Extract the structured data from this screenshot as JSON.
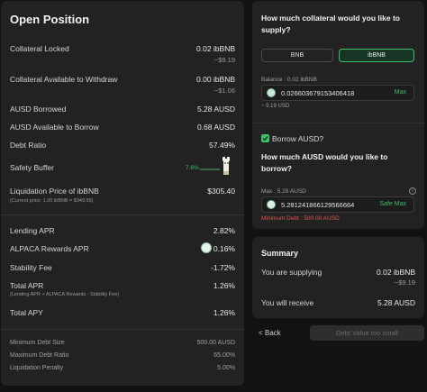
{
  "left": {
    "title": "Open Position",
    "rows": [
      {
        "label": "Collateral Locked",
        "value": "0.02 ibBNB",
        "sub": "~$9.19"
      },
      {
        "label": "Collateral Available to Withdraw",
        "value": "0.00 ibBNB",
        "sub": "~$1.06"
      },
      {
        "label": "AUSD Borrowed",
        "value": "5.28 AUSD"
      },
      {
        "label": "AUSD Available to Borrow",
        "value": "0.68 AUSD"
      },
      {
        "label": "Debt Ratio",
        "value": "57.49%"
      },
      {
        "label": "Safety Buffer",
        "value": "7.6%"
      },
      {
        "label": "Liquidation Price of ibBNB",
        "value": "$305.40",
        "note": "(Current price: 1.00 ibBNB = $349.56)"
      },
      {
        "label": "Lending APR",
        "value": "2.82%"
      },
      {
        "label": "ALPACA Rewards APR",
        "value": "0.16%"
      },
      {
        "label": "Stability Fee",
        "value": "-1.72%"
      },
      {
        "label": "Total APR",
        "value": "1.26%",
        "note": "(Lending APR + ALPACA Rewards - Stability Fee)"
      },
      {
        "label": "Total APY",
        "value": "1.26%"
      }
    ],
    "footer": [
      {
        "label": "Minimum Debt Size",
        "value": "500.00 AUSD"
      },
      {
        "label": "Maximum Debt Ratio",
        "value": "65.00%"
      },
      {
        "label": "Liquidation Penalty",
        "value": "5.00%"
      }
    ]
  },
  "supply": {
    "question": "How much collateral would you like to supply?",
    "tabs": [
      "BNB",
      "ibBNB"
    ],
    "balance_label": "Balance : 0.02 ibBNB",
    "input_value": "0.026603679153406418",
    "max_label": "Max",
    "usd": "~ 9.19 USD"
  },
  "borrow": {
    "checkbox_label": "Borrow AUSD?",
    "question": "How much AUSD would you like to borrow?",
    "max_info": "Max : 5.28 AUSD",
    "input_value": "5.281241866129566664",
    "safe_max_label": "Safe Max",
    "min_debt": "Minimum Debt : 500.00 AUSD"
  },
  "summary": {
    "title": "Summary",
    "supplying_label": "You are supplying",
    "supplying_value": "0.02 ibBNB",
    "supplying_sub": "~$9.19",
    "receive_label": "You will receive",
    "receive_value": "5.28 AUSD"
  },
  "nav": {
    "back": "< Back",
    "submit": "Debt Value too small"
  },
  "colors": {
    "accent": "#3fbf6a",
    "error": "#e05a4a",
    "panel": "#222222"
  }
}
